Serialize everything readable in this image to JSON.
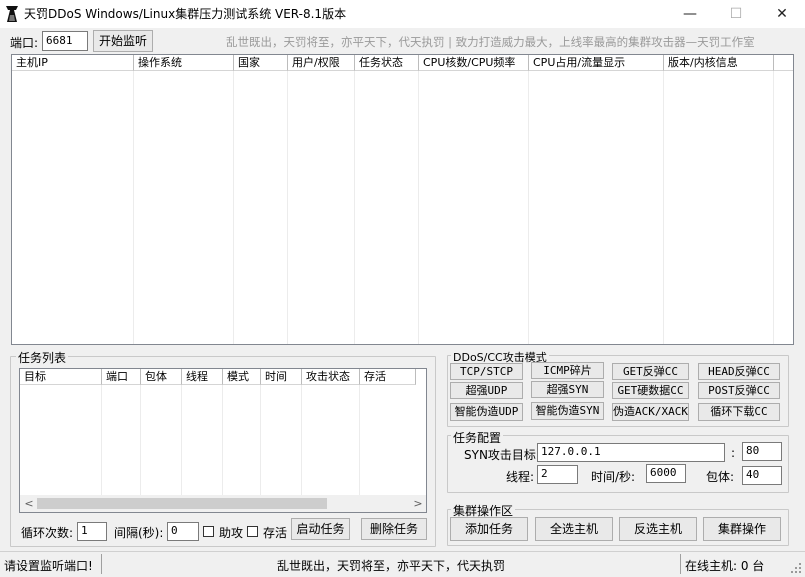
{
  "window": {
    "title": "天罚DDoS Windows/Linux集群压力测试系统 VER-8.1版本",
    "minimize": "—",
    "maximize": "☐",
    "close": "✕"
  },
  "toolbar": {
    "port_label": "端口:",
    "port_value": "6681",
    "start_listen": "开始监听",
    "slogan": "乱世既出，天罚将至，亦平天下，代天执罚 | 致力打造威力最大，上线率最高的集群攻击器—天罚工作室"
  },
  "hosts_table": {
    "columns": [
      "主机IP",
      "操作系统",
      "国家",
      "用户/权限",
      "任务状态",
      "CPU核数/CPU频率",
      "CPU占用/流量显示",
      "版本/内核信息"
    ]
  },
  "task_list": {
    "title": "任务列表",
    "columns": [
      "目标",
      "端口",
      "包体",
      "线程",
      "模式",
      "时间",
      "攻击状态",
      "存活"
    ],
    "scroll_left": "<",
    "scroll_right": ">",
    "loop_label": "循环次数:",
    "loop_value": "1",
    "interval_label": "间隔(秒):",
    "interval_value": "0",
    "assist_label": "助攻",
    "survive_label": "存活",
    "start_task": "启动任务",
    "delete_task": "删除任务"
  },
  "attack_modes": {
    "title": "DDoS/CC攻击模式",
    "buttons": [
      [
        "TCP/STCP",
        "ICMP碎片",
        "GET反弹CC",
        "HEAD反弹CC"
      ],
      [
        "超强UDP",
        "超强SYN",
        "GET硬数据CC",
        "POST反弹CC"
      ],
      [
        "智能伪造UDP",
        "智能伪造SYN",
        "伪造ACK/XACK",
        "循环下载CC"
      ]
    ]
  },
  "task_config": {
    "title": "任务配置",
    "target_label": "SYN攻击目标:",
    "target_value": "127.0.0.1",
    "colon": ":",
    "port_value": "80",
    "threads_label": "线程:",
    "threads_value": "2",
    "time_label": "时间/秒:",
    "time_value": "6000",
    "packet_label": "包体:",
    "packet_value": "40"
  },
  "cluster_ops": {
    "title": "集群操作区",
    "buttons": [
      "添加任务",
      "全选主机",
      "反选主机",
      "集群操作"
    ]
  },
  "statusbar": {
    "left": "请设置监听端口!",
    "center": "乱世既出，天罚将至，亦平天下，代天执罚",
    "right": "在线主机: 0 台"
  }
}
